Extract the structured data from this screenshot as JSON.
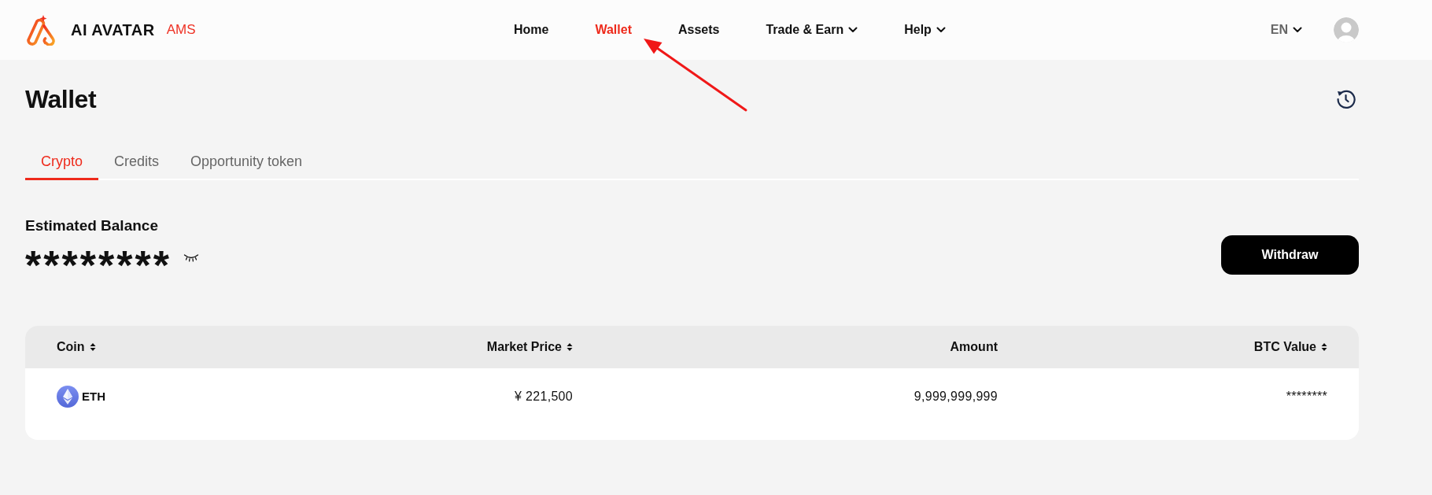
{
  "header": {
    "brand": {
      "name": "AI AVATAR",
      "tag": "AMS"
    },
    "nav": [
      {
        "label": "Home",
        "selected": false,
        "dropdown": false
      },
      {
        "label": "Wallet",
        "selected": true,
        "dropdown": false
      },
      {
        "label": "Assets",
        "selected": false,
        "dropdown": false
      },
      {
        "label": "Trade & Earn",
        "selected": false,
        "dropdown": true
      },
      {
        "label": "Help",
        "selected": false,
        "dropdown": true
      }
    ],
    "language": {
      "label": "EN"
    }
  },
  "page": {
    "title": "Wallet"
  },
  "tabs": [
    {
      "label": "Crypto",
      "selected": true
    },
    {
      "label": "Credits",
      "selected": false
    },
    {
      "label": "Opportunity token",
      "selected": false
    }
  ],
  "balance": {
    "label": "Estimated Balance",
    "value": "********",
    "hidden": true
  },
  "withdraw_button": {
    "label": "Withdraw"
  },
  "table": {
    "columns": [
      {
        "label": "Coin",
        "sortable": true
      },
      {
        "label": "Market Price",
        "sortable": true
      },
      {
        "label": "Amount",
        "sortable": false
      },
      {
        "label": "BTC Value",
        "sortable": true
      }
    ],
    "rows": [
      {
        "cells": [
          "ETH",
          "¥ 221,500",
          "9,999,999,999",
          "********"
        ]
      }
    ]
  }
}
